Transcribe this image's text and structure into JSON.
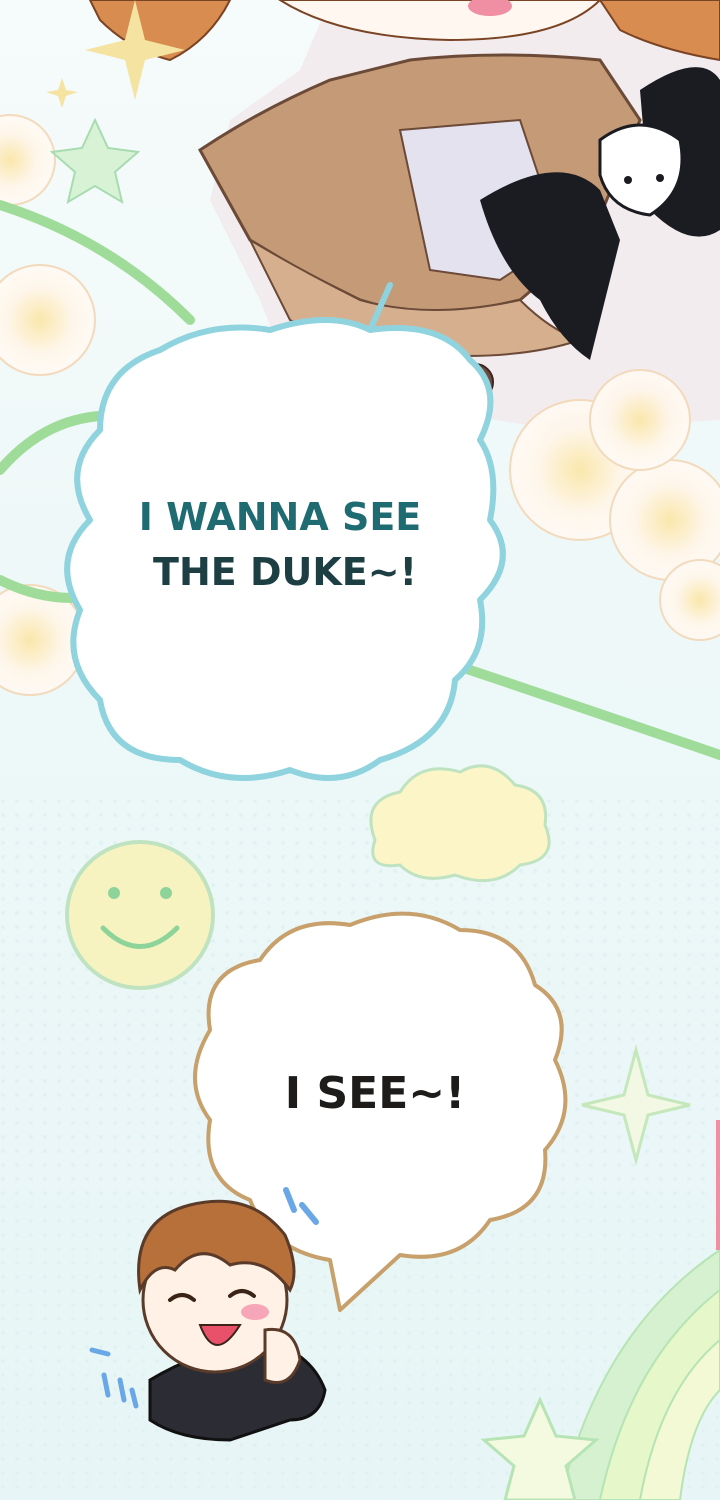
{
  "bubbles": [
    {
      "lines": [
        "I WANNA SEE",
        "THE DUKE~!"
      ],
      "text_color": "#1f6b72",
      "outline_color": "#8fd3df"
    },
    {
      "lines": [
        "I SEE~!"
      ],
      "text_color": "#1d1c1a",
      "accent_color": "#a87a18",
      "outline_color": "#c7a06b"
    }
  ],
  "palette": {
    "background": "#eef8f9",
    "green_line": "#9fdc9a",
    "sparkle": "#f4e3a1",
    "star": "#d8f2d6",
    "cloud": "#fbf5c8",
    "smiley": "#f7f3c0",
    "rainbow": [
      "#d6f1cf",
      "#e6f7c9",
      "#f2f9d4"
    ]
  },
  "icons": [
    "sparkle-icon",
    "star-icon",
    "smiley-icon",
    "cloud-icon",
    "rainbow-icon",
    "shooting-star-icon"
  ]
}
